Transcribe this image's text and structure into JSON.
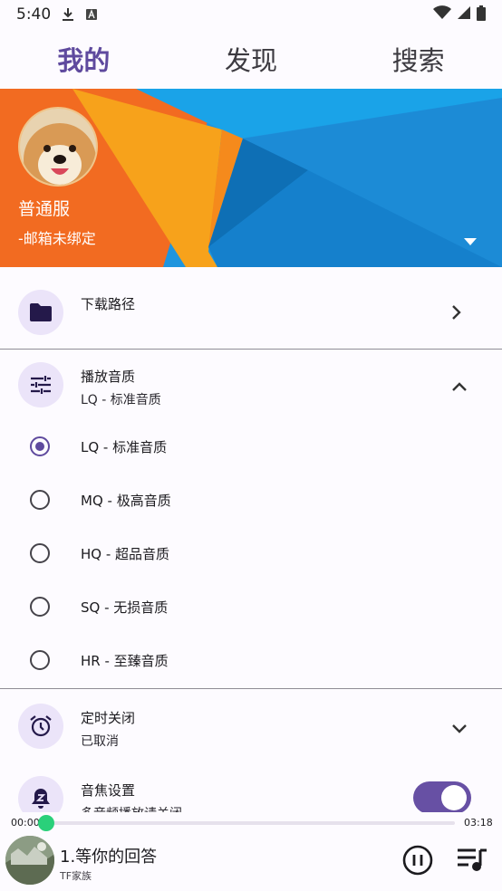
{
  "status_bar": {
    "time": "5:40",
    "icons": [
      "download-icon",
      "keyboard-a-icon",
      "wifi-icon",
      "signal-icon",
      "battery-icon"
    ]
  },
  "tabs": [
    {
      "label": "我的",
      "active": true
    },
    {
      "label": "发现",
      "active": false
    },
    {
      "label": "搜索",
      "active": false
    }
  ],
  "profile": {
    "server": "普通服",
    "email": "-邮箱未绑定",
    "banner_colors": [
      "#f26b21",
      "#f9ab1a",
      "#1e8ad8",
      "#0d6fb8"
    ]
  },
  "settings": {
    "download_path": {
      "title": "下载路径",
      "icon": "folder-icon"
    },
    "play_quality": {
      "title": "播放音质",
      "current": "LQ - 标准音质",
      "icon": "tune-icon",
      "options": [
        {
          "label": "LQ - 标准音质",
          "selected": true
        },
        {
          "label": "MQ - 极高音质",
          "selected": false
        },
        {
          "label": "HQ - 超品音质",
          "selected": false
        },
        {
          "label": "SQ - 无损音质",
          "selected": false
        },
        {
          "label": "HR - 至臻音质",
          "selected": false
        }
      ]
    },
    "timer": {
      "title": "定时关闭",
      "status": "已取消",
      "icon": "alarm-icon"
    },
    "audio_focus": {
      "title": "音焦设置",
      "sub": "多音频播放请关闭",
      "icon": "notification-z-icon",
      "enabled": true
    }
  },
  "player": {
    "current_time": "00:00",
    "total_time": "03:18",
    "progress": 0.0,
    "song": "1.等你的回答",
    "artist": "TF家族"
  },
  "colors": {
    "accent": "#5f4a9e",
    "progress_thumb": "#2ad07a",
    "icon_circle": "#ebe4f9"
  }
}
